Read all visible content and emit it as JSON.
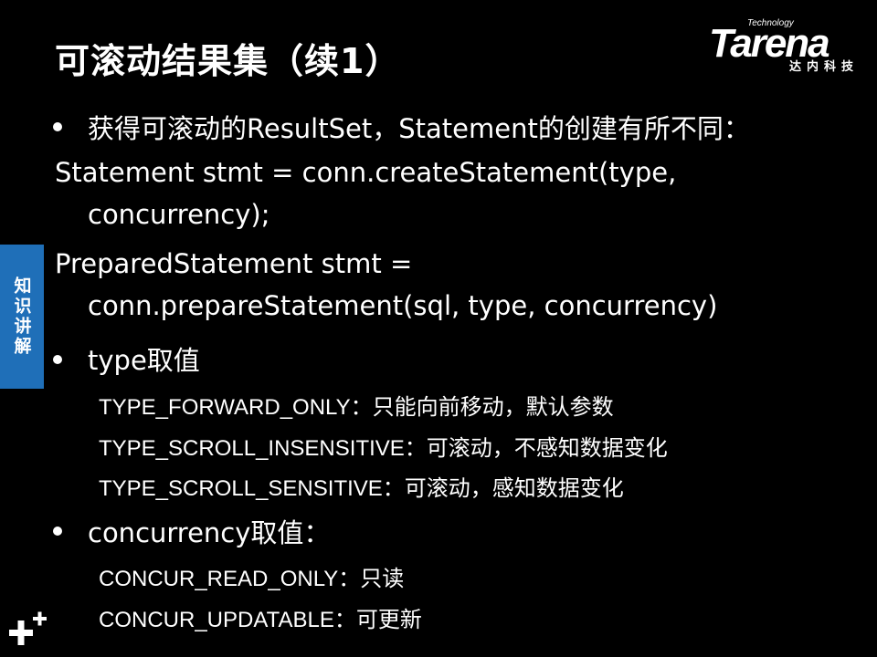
{
  "title": "可滚动结果集（续1）",
  "logo": {
    "wordmark": "Tarena",
    "tagline": "Technology",
    "subtitle": "达内科技"
  },
  "side_tab": {
    "label": "知识讲解"
  },
  "content": {
    "intro_bullet": "获得可滚动的ResultSet，Statement的创建有所不同：",
    "code_line1_a": "Statement stmt = conn.createStatement(type,",
    "code_line1_b": "concurrency);",
    "code_line2_a": "PreparedStatement stmt =",
    "code_line2_b": "conn.prepareStatement(sql, type, concurrency)",
    "type_bullet": "type取值",
    "type_values": [
      "TYPE_FORWARD_ONLY：只能向前移动，默认参数",
      "TYPE_SCROLL_INSENSITIVE：可滚动，不感知数据变化",
      "TYPE_SCROLL_SENSITIVE：可滚动，感知数据变化"
    ],
    "concurrency_bullet": "concurrency取值：",
    "concurrency_values": [
      "CONCUR_READ_ONLY：只读",
      "CONCUR_UPDATABLE：可更新"
    ]
  },
  "colors": {
    "background": "#000000",
    "text": "#ffffff",
    "side_tab": "#1f6fb8"
  },
  "icons": {
    "corner_mark": "plus-plus-icon"
  }
}
